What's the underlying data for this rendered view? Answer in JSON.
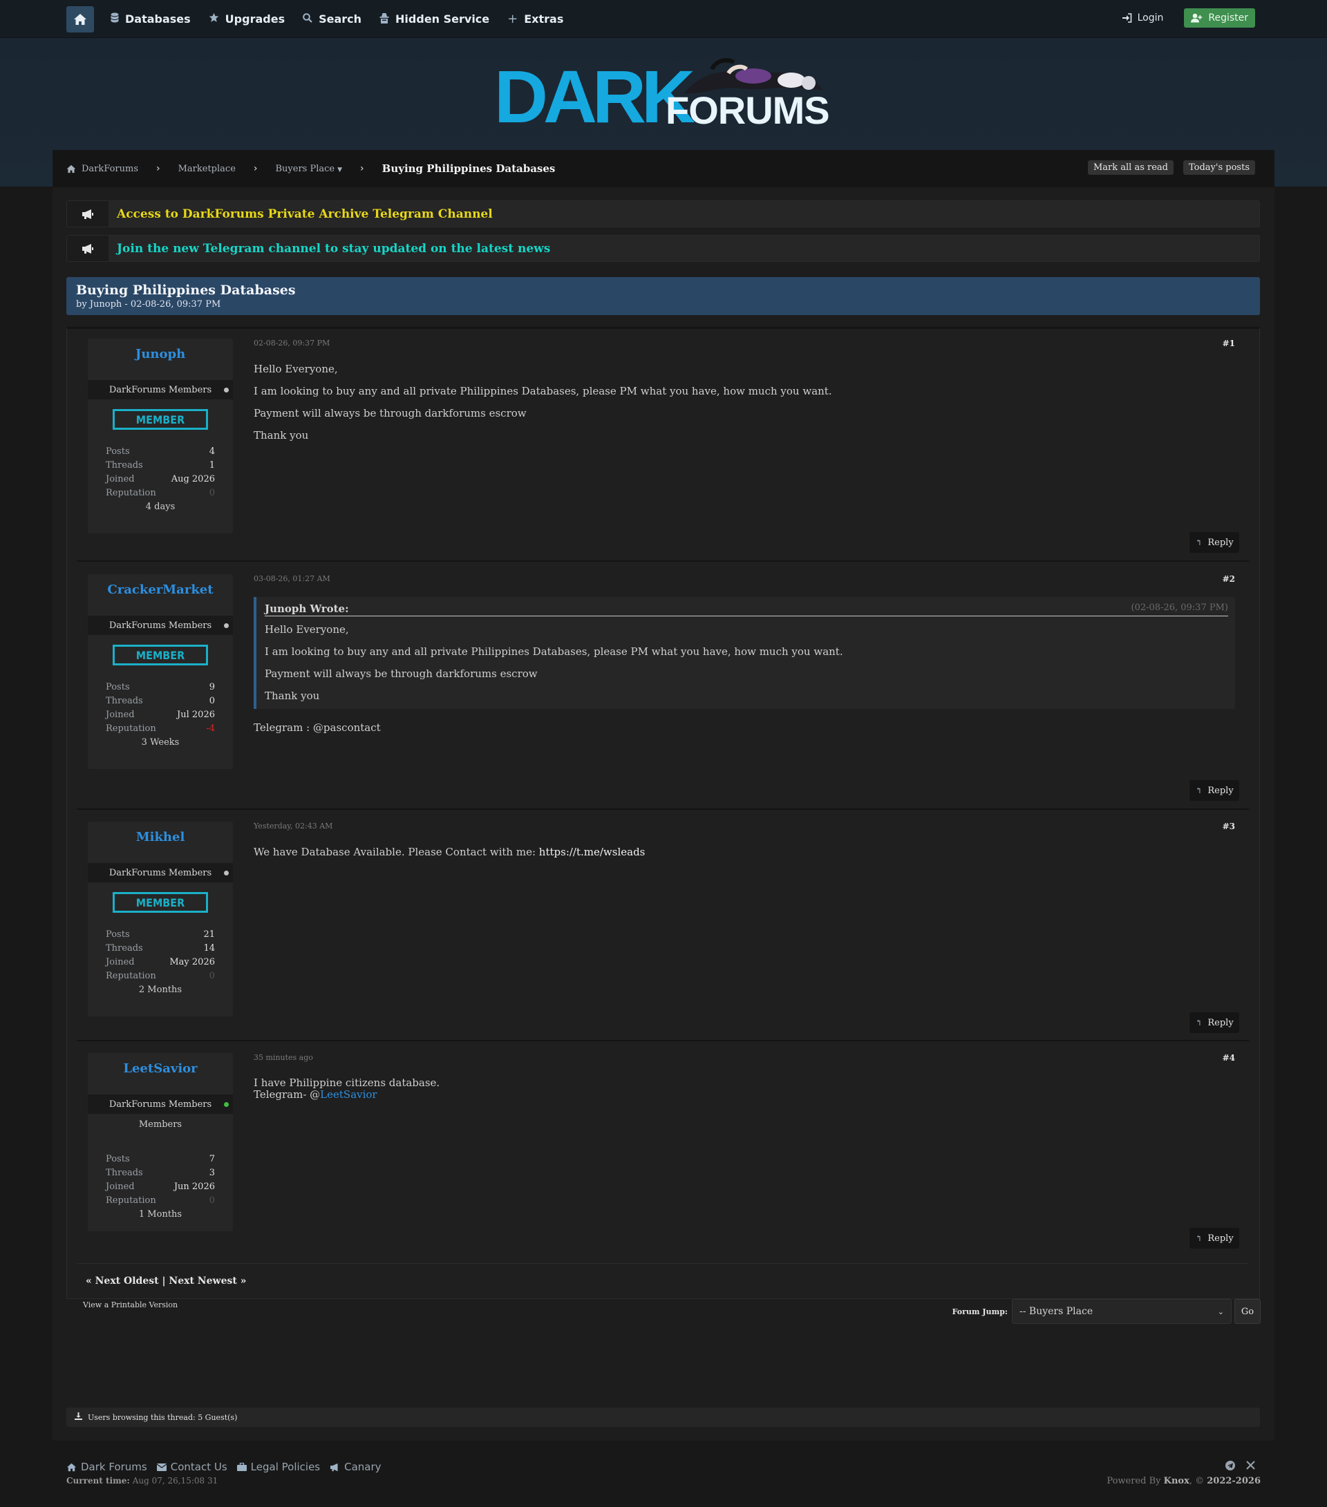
{
  "nav": {
    "items": [
      {
        "label": "Databases",
        "icon": "database-icon"
      },
      {
        "label": "Upgrades",
        "icon": "star-icon"
      },
      {
        "label": "Search",
        "icon": "search-icon"
      },
      {
        "label": "Hidden Service",
        "icon": "spy-icon"
      },
      {
        "label": "Extras",
        "icon": "plus-icon"
      }
    ],
    "login": "Login",
    "register": "Register"
  },
  "logo": {
    "dark": "DARK",
    "forums": "FORUMS"
  },
  "breadcrumb": {
    "items": [
      "DarkForums",
      "Marketplace",
      "Buyers Place"
    ],
    "current": "Buying Philippines Databases",
    "mark_read": "Mark all as read",
    "todays_posts": "Today's posts"
  },
  "announcements": [
    {
      "text": "Access to DarkForums Private Archive Telegram Channel",
      "color": "#e8d818"
    },
    {
      "text": "Join the new Telegram channel to stay updated on the latest news",
      "color": "#16d6c8"
    }
  ],
  "thread": {
    "title": "Buying Philippines Databases",
    "subtitle": "by Junoph - 02-08-26, 09:37 PM"
  },
  "posts": [
    {
      "author": "Junoph",
      "group": "DarkForums Members",
      "badge": "MEMBER",
      "stats": {
        "posts": "4",
        "threads": "1",
        "joined": "Aug 2026",
        "reputation": "0",
        "age": "4 days"
      },
      "date": "02-08-26, 09:37 PM",
      "num": "#1",
      "lines": [
        "Hello Everyone,",
        "I am looking to buy any and all private Philippines Databases, please PM what you have, how much you want.",
        "Payment will always be through darkforums escrow",
        "Thank you"
      ]
    },
    {
      "author": "CrackerMarket",
      "group": "DarkForums Members",
      "badge": "MEMBER",
      "stats": {
        "posts": "9",
        "threads": "0",
        "joined": "Jul 2026",
        "reputation": "-4",
        "age": "3 Weeks"
      },
      "date": "03-08-26, 01:27 AM",
      "num": "#2",
      "quote": {
        "who": "Junoph Wrote:",
        "when": "(02-08-26, 09:37 PM)",
        "lines": [
          "Hello Everyone,",
          "I am looking to buy any and all private Philippines Databases, please PM what you have, how much you want.",
          "Payment will always be through darkforums escrow",
          "Thank you"
        ]
      },
      "after": "Telegram : @pascontact"
    },
    {
      "author": "Mikhel",
      "group": "DarkForums Members",
      "badge": "MEMBER",
      "stats": {
        "posts": "21",
        "threads": "14",
        "joined": "May 2026",
        "reputation": "0",
        "age": "2 Months"
      },
      "date": "Yesterday, 02:43 AM",
      "num": "#3",
      "text": "We have Database Available. Please Contact with me: ",
      "link": "https://t.me/wsleads"
    },
    {
      "author": "LeetSavior",
      "group": "DarkForums Members",
      "group_sub": "Members",
      "stats": {
        "posts": "7",
        "threads": "3",
        "joined": "Jun 2026",
        "reputation": "0",
        "age": "1 Months"
      },
      "date": "35 minutes ago",
      "num": "#4",
      "line1": "I have Philippine citizens database.",
      "line2_prefix": "Telegram- @",
      "line2_mention": "LeetSavior"
    }
  ],
  "labels": {
    "posts": "Posts",
    "threads": "Threads",
    "joined": "Joined",
    "reputation": "Reputation",
    "reply": "Reply"
  },
  "next_links": "« Next Oldest | Next Newest »",
  "printable": "View a Printable Version",
  "forum_jump": {
    "label": "Forum Jump:",
    "selected": "-- Buyers Place",
    "go": "Go"
  },
  "browsing": "Users browsing this thread: 5 Guest(s)",
  "footer": {
    "links": [
      "Dark Forums",
      "Contact Us",
      "Legal Policies",
      "Canary"
    ],
    "current_time_label": "Current time:",
    "current_time": "Aug 07, 26,15:08 31",
    "powered_prefix": "Powered By",
    "powered_name": "Knox",
    "powered_suffix": ", ©",
    "powered_years": "2022-2026"
  }
}
